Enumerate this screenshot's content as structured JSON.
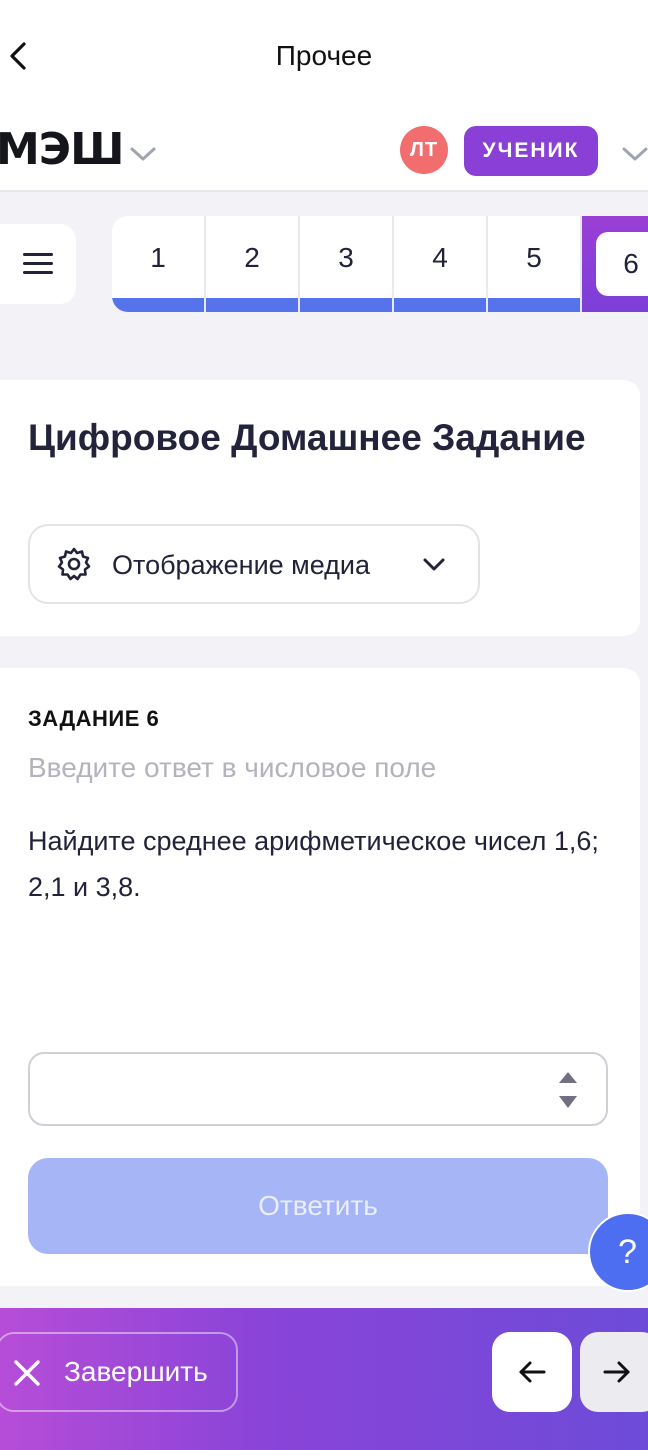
{
  "topbar": {
    "title": "Прочее"
  },
  "appbar": {
    "logo": "МЭШ",
    "avatar_initials": "ЛТ",
    "role": "УЧЕНИК"
  },
  "task_nav": {
    "items": [
      {
        "label": "1"
      },
      {
        "label": "2"
      },
      {
        "label": "3"
      },
      {
        "label": "4"
      },
      {
        "label": "5"
      }
    ],
    "active": {
      "label": "6"
    }
  },
  "header_card": {
    "title": "Цифровое Домашнее Задание",
    "media_label": "Отображение медиа"
  },
  "task": {
    "label": "ЗАДАНИЕ 6",
    "hint": "Введите ответ в числовое поле",
    "text": "Найдите среднее арифметическое чисел 1,6; 2,1 и 3,8.",
    "input_value": "",
    "submit_label": "Ответить"
  },
  "help": {
    "label": "?"
  },
  "bottombar": {
    "finish_label": "Завершить"
  },
  "colors": {
    "accent": "#8a3fd6",
    "primary": "#5573ea",
    "submit_disabled": "#a5b5f6",
    "avatar": "#f26d6d"
  }
}
